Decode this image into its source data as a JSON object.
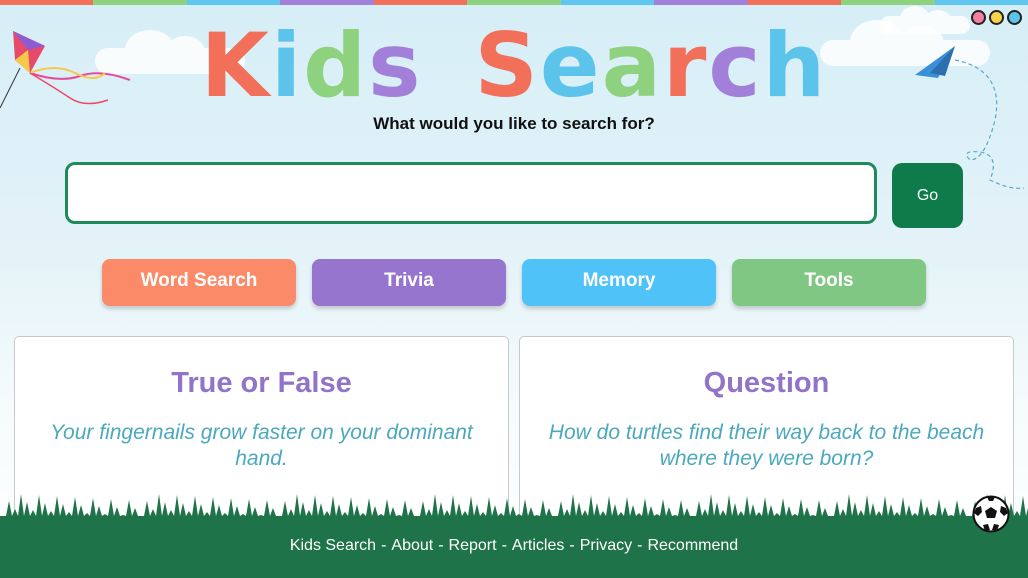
{
  "colors": {
    "topbar": [
      "#f2705a",
      "#8ed17e",
      "#5fc7ef",
      "#a27fd9",
      "#f2705a",
      "#8ed17e",
      "#5fc7ef",
      "#a27fd9",
      "#f2705a",
      "#8ed17e",
      "#5fc7ef"
    ],
    "title_letters": [
      "#f2705a",
      "#5cc3ea",
      "#8ed17e",
      "#a27fd9",
      "#ffffff",
      "#f2705a",
      "#5cc3ea",
      "#8ed17e",
      "#f2705a",
      "#a27fd9",
      "#5cc3ea"
    ],
    "dots": [
      "#f27fa0",
      "#f7d24a",
      "#5cc3ea"
    ]
  },
  "header": {
    "title_letters": [
      "K",
      "i",
      "d",
      "s",
      " ",
      "S",
      "e",
      "a",
      "r",
      "c",
      "h"
    ],
    "subtitle": "What would you like to search for?"
  },
  "search": {
    "value": "",
    "placeholder": "",
    "go_label": "Go"
  },
  "categories": [
    {
      "label": "Word Search",
      "color": "#fb8a68"
    },
    {
      "label": "Trivia",
      "color": "#9575cd"
    },
    {
      "label": "Memory",
      "color": "#4fc3f7"
    },
    {
      "label": "Tools",
      "color": "#81c784"
    }
  ],
  "cards": [
    {
      "title": "True or False",
      "text": "Your fingernails grow faster on your dominant hand."
    },
    {
      "title": "Question",
      "text": "How do turtles find their way back to the beach where they were born?"
    }
  ],
  "footer": {
    "links": [
      "Kids Search",
      "About",
      "Report",
      "Articles",
      "Privacy",
      "Recommend"
    ],
    "separator": "-"
  },
  "icons": [
    "kite-icon",
    "paper-plane-icon",
    "soccer-ball-icon",
    "grass-decoration"
  ]
}
